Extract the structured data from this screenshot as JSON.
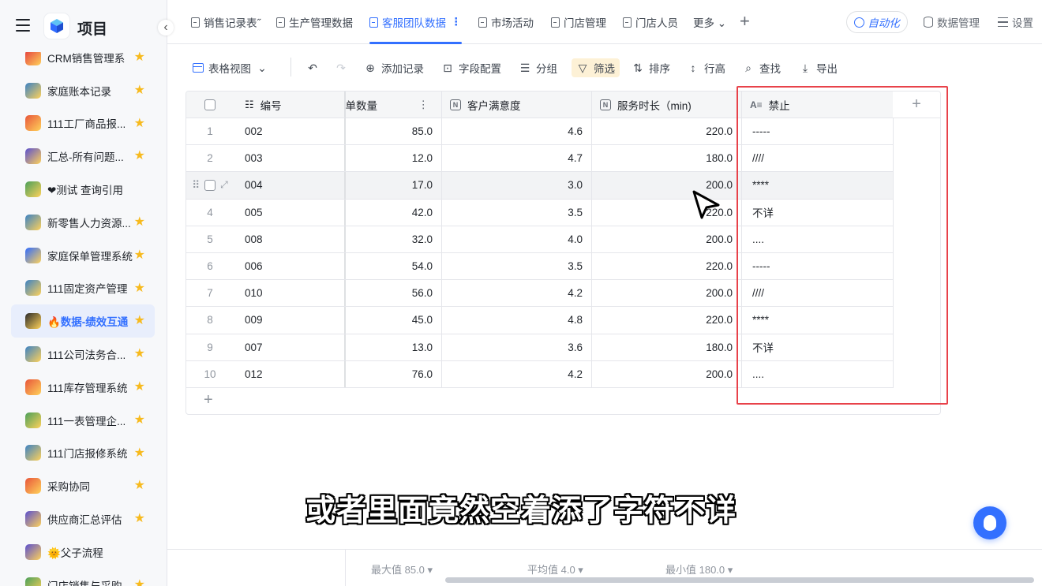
{
  "app": {
    "title": "项目"
  },
  "sidebar": {
    "items": [
      {
        "label": "CRM销售管理系",
        "color": "#e43d3d",
        "starred": true
      },
      {
        "label": "家庭账本记录",
        "color": "#3b82c4",
        "starred": true
      },
      {
        "label": "111工厂商品报...",
        "color": "#e8553a",
        "starred": true
      },
      {
        "label": "汇总-所有问题...",
        "color": "#5a4fcf",
        "starred": true
      },
      {
        "label": "❤测试 查询引用",
        "color": "#4aa05a",
        "starred": false
      },
      {
        "label": "新零售人力资源...",
        "color": "#3b82c4",
        "starred": true
      },
      {
        "label": "家庭保单管理系统",
        "color": "#2f6bff",
        "starred": true
      },
      {
        "label": "111固定资产管理",
        "color": "#3b82c4",
        "starred": true
      },
      {
        "label": "🔥数据-绩效互通",
        "color": "#2b2b2b",
        "starred": true,
        "active": true
      },
      {
        "label": "111公司法务合...",
        "color": "#3b82c4",
        "starred": true
      },
      {
        "label": "111库存管理系统",
        "color": "#e8553a",
        "starred": true
      },
      {
        "label": "111一表管理企...",
        "color": "#4aa05a",
        "starred": true
      },
      {
        "label": "111门店报修系统",
        "color": "#3b82c4",
        "starred": true
      },
      {
        "label": "采购协同",
        "color": "#e8553a",
        "starred": true
      },
      {
        "label": "供应商汇总评估",
        "color": "#5a4fcf",
        "starred": true
      },
      {
        "label": "🌞父子流程",
        "color": "#5a4fcf",
        "starred": false
      },
      {
        "label": "门店销售与采购",
        "color": "#4aa05a",
        "starred": true
      }
    ]
  },
  "tabs": [
    {
      "label": "销售记录表˝",
      "active": false
    },
    {
      "label": "生产管理数据",
      "active": false
    },
    {
      "label": "客服团队数据",
      "active": true
    },
    {
      "label": "市场活动",
      "active": false
    },
    {
      "label": "门店管理",
      "active": false
    },
    {
      "label": "门店人员",
      "active": false
    },
    {
      "label": "更多 ⌄",
      "active": false
    }
  ],
  "header_right": {
    "automation": "自动化",
    "data_manage": "数据管理",
    "settings": "设置"
  },
  "toolbar": {
    "view": "表格视图",
    "add_record": "添加记录",
    "field_config": "字段配置",
    "group": "分组",
    "filter": "筛选",
    "sort": "排序",
    "row_height": "行高",
    "find": "查找",
    "export": "导出"
  },
  "table": {
    "columns": {
      "id": "编号",
      "qty": "订单数量",
      "satisfaction": "客户满意度",
      "duration": "服务时长（min)",
      "forbidden": "禁止"
    },
    "rows": [
      {
        "n": "1",
        "id": "002",
        "qty": "85.0",
        "sat": "4.6",
        "dur": "220.0",
        "forb": "-----"
      },
      {
        "n": "2",
        "id": "003",
        "qty": "12.0",
        "sat": "4.7",
        "dur": "180.0",
        "forb": "////"
      },
      {
        "n": "3",
        "id": "004",
        "qty": "17.0",
        "sat": "3.0",
        "dur": "200.0",
        "forb": "****"
      },
      {
        "n": "4",
        "id": "005",
        "qty": "42.0",
        "sat": "3.5",
        "dur": "220.0",
        "forb": "不详"
      },
      {
        "n": "5",
        "id": "008",
        "qty": "32.0",
        "sat": "4.0",
        "dur": "200.0",
        "forb": "...."
      },
      {
        "n": "6",
        "id": "006",
        "qty": "54.0",
        "sat": "3.5",
        "dur": "220.0",
        "forb": "-----"
      },
      {
        "n": "7",
        "id": "010",
        "qty": "56.0",
        "sat": "4.2",
        "dur": "200.0",
        "forb": "////"
      },
      {
        "n": "8",
        "id": "009",
        "qty": "45.0",
        "sat": "4.8",
        "dur": "220.0",
        "forb": "****"
      },
      {
        "n": "9",
        "id": "007",
        "qty": "13.0",
        "sat": "3.6",
        "dur": "180.0",
        "forb": "不详"
      },
      {
        "n": "10",
        "id": "012",
        "qty": "76.0",
        "sat": "4.2",
        "dur": "200.0",
        "forb": "...."
      }
    ]
  },
  "footer": {
    "max": "最大值 85.0 ▾",
    "avg": "平均值 4.0 ▾",
    "min": "最小值 180.0 ▾"
  },
  "subtitle": "或者里面竟然空着添了字符不详",
  "colors": {
    "accent": "#3370ff",
    "highlight": "#e8424a",
    "star": "#f7ba1e"
  }
}
